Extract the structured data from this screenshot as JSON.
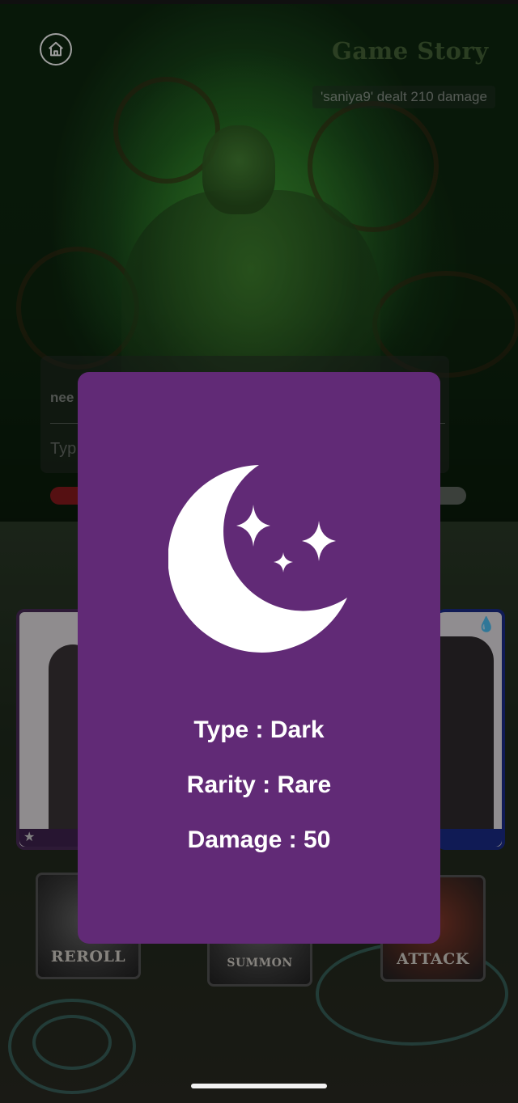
{
  "header": {
    "title": "Game Story",
    "home_icon": "home-icon"
  },
  "battle_log": {
    "message": "'saniya9' dealt 210 damage"
  },
  "chat": {
    "partial_message_line1": "",
    "partial_message_line2": "nee",
    "input_placeholder_visible": "Typ"
  },
  "actions": {
    "reroll_label": "REROLL",
    "summon_label": "SUMMON",
    "attack_label": "ATTACK"
  },
  "hero_cards": {
    "left_badge_icon": "star-icon",
    "right_badge_icon": "water-icon"
  },
  "card_modal": {
    "icon": "crescent-moon-stars-icon",
    "background_color": "#612a76",
    "type_line": "Type : Dark",
    "rarity_line": "Rarity : Rare",
    "damage_line": "Damage : 50"
  }
}
